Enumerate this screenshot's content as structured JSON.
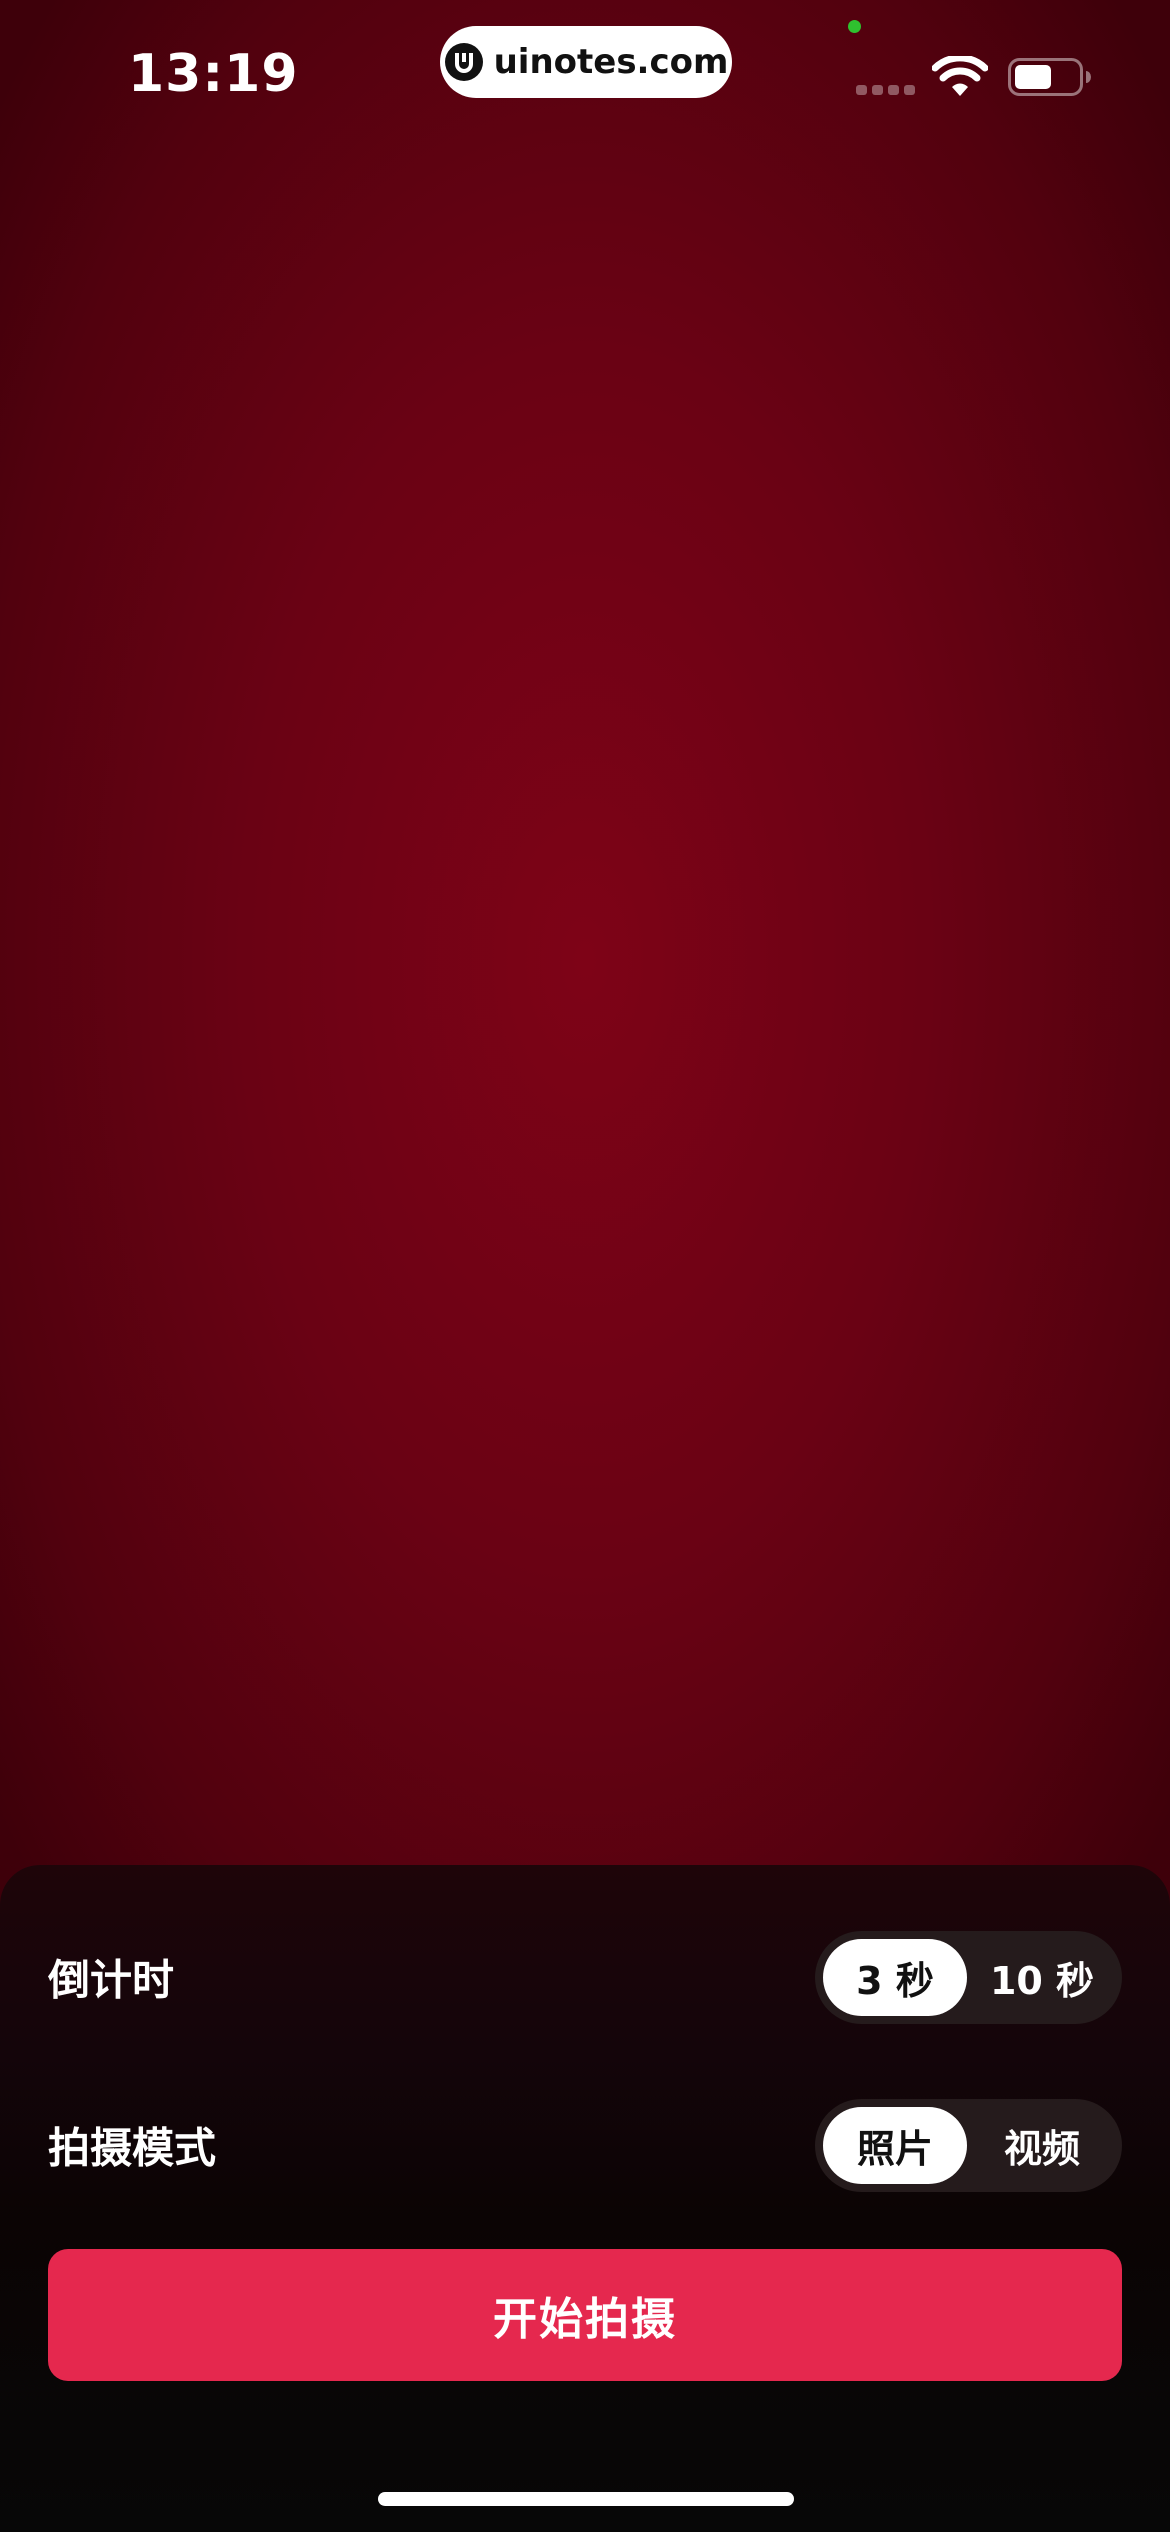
{
  "status_bar": {
    "time": "13:19",
    "watermark": "uinotes.com",
    "signal_icon": "cellular-signal-icon",
    "wifi_icon": "wifi-icon",
    "battery_icon": "battery-icon"
  },
  "settings": {
    "countdown": {
      "label": "倒计时",
      "options": [
        "3 秒",
        "10 秒"
      ],
      "selected": "3 秒"
    },
    "capture_mode": {
      "label": "拍摄模式",
      "options": [
        "照片",
        "视频"
      ],
      "selected": "照片"
    }
  },
  "actions": {
    "start_label": "开始拍摄"
  },
  "colors": {
    "background": "#6e0214",
    "sheet": "#0b0404",
    "accent": "#e5284e",
    "segment_track": "#251b1c",
    "segment_active": "#ffffff",
    "camera_indicator": "#2fc12f"
  }
}
